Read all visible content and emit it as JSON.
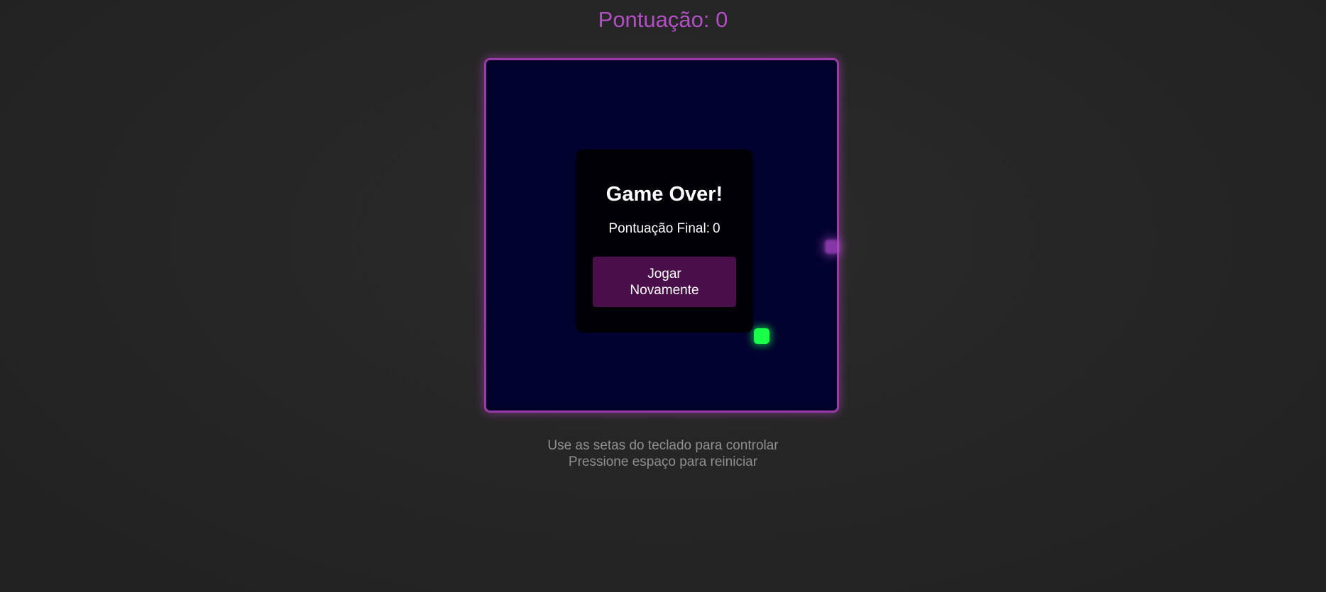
{
  "header": {
    "score_label": "Pontuação: 0"
  },
  "game": {
    "board_color": "#02022e",
    "border_color": "#9a3aa6",
    "snake_color": "#18ff4a",
    "food_color": "#b04bd0",
    "score": 0,
    "state": "game-over"
  },
  "game_over": {
    "title": "Game Over!",
    "final_score_label": "Pontuação Final:",
    "final_score_value": "0",
    "restart_button_label": "Jogar Novamente",
    "button_color": "#4a0f4a"
  },
  "instructions": {
    "line1": "Use as setas do teclado para controlar",
    "line2": "Pressione espaço para reiniciar"
  }
}
